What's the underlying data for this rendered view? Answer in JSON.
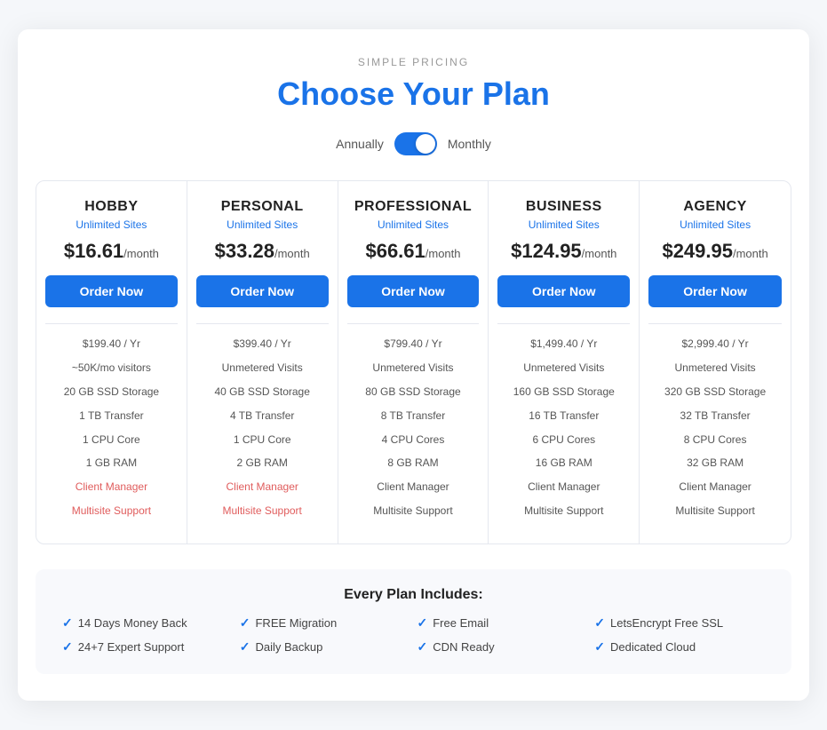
{
  "header": {
    "simple_pricing": "SIMPLE PRICING",
    "title_plain": "Choose Your ",
    "title_accent": "Plan"
  },
  "billing": {
    "annually_label": "Annually",
    "monthly_label": "Monthly"
  },
  "plans": [
    {
      "id": "hobby",
      "name": "HOBBY",
      "sites": "Unlimited Sites",
      "price": "$16.61",
      "per": "/month",
      "order_btn": "Order Now",
      "yearly": "$199.40 / Yr",
      "visitors": "~50K/mo visitors",
      "storage": "20 GB SSD Storage",
      "transfer": "1 TB Transfer",
      "cpu": "1 CPU Core",
      "ram": "1 GB RAM",
      "client_manager": "Client Manager",
      "client_manager_unavailable": true,
      "multisite": "Multisite Support",
      "multisite_unavailable": true
    },
    {
      "id": "personal",
      "name": "PERSONAL",
      "sites": "Unlimited Sites",
      "price": "$33.28",
      "per": "/month",
      "order_btn": "Order Now",
      "yearly": "$399.40 / Yr",
      "visitors": "Unmetered Visits",
      "storage": "40 GB SSD Storage",
      "transfer": "4 TB Transfer",
      "cpu": "1 CPU Core",
      "ram": "2 GB RAM",
      "client_manager": "Client Manager",
      "client_manager_unavailable": true,
      "multisite": "Multisite Support",
      "multisite_unavailable": true
    },
    {
      "id": "professional",
      "name": "PROFESSIONAL",
      "sites": "Unlimited Sites",
      "price": "$66.61",
      "per": "/month",
      "order_btn": "Order Now",
      "yearly": "$799.40 / Yr",
      "visitors": "Unmetered Visits",
      "storage": "80 GB SSD Storage",
      "transfer": "8 TB Transfer",
      "cpu": "4 CPU Cores",
      "ram": "8 GB RAM",
      "client_manager": "Client Manager",
      "client_manager_unavailable": false,
      "multisite": "Multisite Support",
      "multisite_unavailable": false
    },
    {
      "id": "business",
      "name": "BUSINESS",
      "sites": "Unlimited Sites",
      "price": "$124.95",
      "per": "/month",
      "order_btn": "Order Now",
      "yearly": "$1,499.40 / Yr",
      "visitors": "Unmetered Visits",
      "storage": "160 GB SSD Storage",
      "transfer": "16 TB Transfer",
      "cpu": "6 CPU Cores",
      "ram": "16 GB RAM",
      "client_manager": "Client Manager",
      "client_manager_unavailable": false,
      "multisite": "Multisite Support",
      "multisite_unavailable": false
    },
    {
      "id": "agency",
      "name": "AGENCY",
      "sites": "Unlimited Sites",
      "price": "$249.95",
      "per": "/month",
      "order_btn": "Order Now",
      "yearly": "$2,999.40 / Yr",
      "visitors": "Unmetered Visits",
      "storage": "320 GB SSD Storage",
      "transfer": "32 TB Transfer",
      "cpu": "8 CPU Cores",
      "ram": "32 GB RAM",
      "client_manager": "Client Manager",
      "client_manager_unavailable": false,
      "multisite": "Multisite Support",
      "multisite_unavailable": false
    }
  ],
  "includes": {
    "title": "Every Plan Includes:",
    "items": [
      "14 Days Money Back",
      "FREE Migration",
      "Free Email",
      "LetsEncrypt Free SSL",
      "24+7 Expert Support",
      "Daily Backup",
      "CDN Ready",
      "Dedicated Cloud"
    ]
  }
}
